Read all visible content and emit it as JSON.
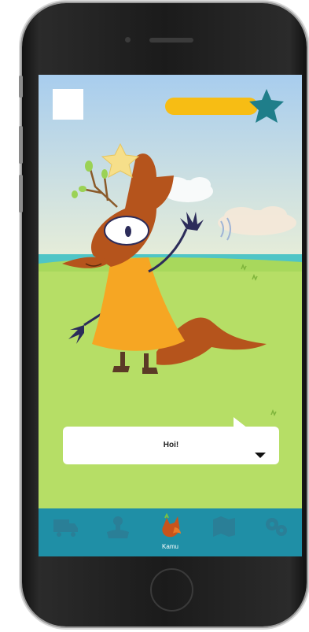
{
  "game": {
    "menu_label": "",
    "dialog_text": "Hoi!",
    "progress": 0.72
  },
  "tabs": [
    {
      "label": "",
      "icon": "truck-icon"
    },
    {
      "label": "",
      "icon": "controller-icon"
    },
    {
      "label": "Kamu",
      "icon": "fox-icon",
      "active": true
    },
    {
      "label": "",
      "icon": "map-icon"
    },
    {
      "label": "",
      "icon": "settings-icon"
    }
  ],
  "colors": {
    "sky": "#b9d6ee",
    "grass": "#b6de66",
    "fox": "#b5541c",
    "dress": "#f6a623",
    "progress_bar": "#f7bd14",
    "star": "#1f7e8a",
    "tabbar": "#1f8fa6"
  }
}
